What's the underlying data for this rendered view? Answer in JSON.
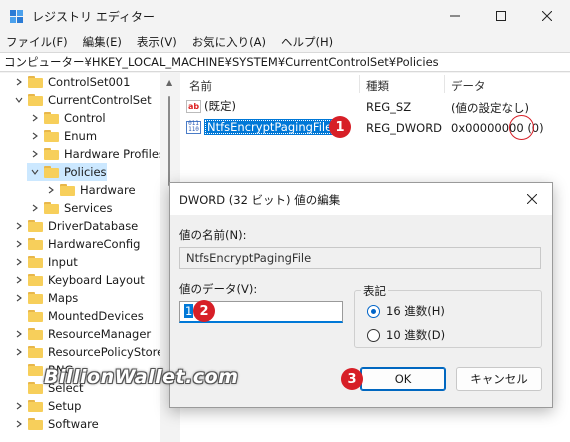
{
  "window": {
    "title": "レジストリ エディター",
    "app_icon": "registry-editor-icon",
    "controls": [
      "minimize-icon",
      "maximize-icon",
      "close-icon"
    ]
  },
  "menu": {
    "items": [
      "ファイル(F)",
      "編集(E)",
      "表示(V)",
      "お気に入り(A)",
      "ヘルプ(H)"
    ]
  },
  "address": {
    "path": "コンピューター¥HKEY_LOCAL_MACHINE¥SYSTEM¥CurrentControlSet¥Policies"
  },
  "tree": {
    "items": [
      {
        "label": "ControlSet001",
        "expander": "chevron-right",
        "selected": false
      },
      {
        "label": "CurrentControlSet",
        "expander": "chevron-down",
        "selected": false
      },
      {
        "label": "Control",
        "expander": "chevron-right",
        "selected": false
      },
      {
        "label": "Enum",
        "expander": "chevron-right",
        "selected": false
      },
      {
        "label": "Hardware Profiles",
        "expander": "chevron-right",
        "selected": false
      },
      {
        "label": "Policies",
        "expander": "chevron-down",
        "selected": true
      },
      {
        "label": "Hardware",
        "expander": "chevron-right",
        "selected": false
      },
      {
        "label": "Services",
        "expander": "chevron-right",
        "selected": false
      },
      {
        "label": "DriverDatabase",
        "expander": "chevron-right",
        "selected": false
      },
      {
        "label": "HardwareConfig",
        "expander": "chevron-right",
        "selected": false
      },
      {
        "label": "Input",
        "expander": "chevron-right",
        "selected": false
      },
      {
        "label": "Keyboard Layout",
        "expander": "chevron-right",
        "selected": false
      },
      {
        "label": "Maps",
        "expander": "chevron-right",
        "selected": false
      },
      {
        "label": "MountedDevices",
        "expander": "none",
        "selected": false
      },
      {
        "label": "ResourceManager",
        "expander": "chevron-right",
        "selected": false
      },
      {
        "label": "ResourcePolicyStore",
        "expander": "chevron-right",
        "selected": false
      },
      {
        "label": "RNG",
        "expander": "none",
        "selected": false
      },
      {
        "label": "Select",
        "expander": "none",
        "selected": false
      },
      {
        "label": "Setup",
        "expander": "chevron-right",
        "selected": false
      },
      {
        "label": "Software",
        "expander": "chevron-right",
        "selected": false
      }
    ]
  },
  "list": {
    "headers": {
      "name": "名前",
      "type": "種類",
      "data": "データ"
    },
    "rows": [
      {
        "icon": "string-value-icon",
        "name": "(既定)",
        "type": "REG_SZ",
        "data": "(値の設定なし)",
        "selected": false
      },
      {
        "icon": "binary-value-icon",
        "name": "NtfsEncryptPagingFile",
        "type": "REG_DWORD",
        "data": "0x00000000",
        "data_suffix": "(0)",
        "selected": true
      }
    ]
  },
  "annotations": {
    "step1": "1",
    "step2": "2",
    "step3": "3",
    "accent": "#d71f27"
  },
  "dialog": {
    "title": "DWORD (32 ビット) 値の編集",
    "value_name_label": "値の名前(N):",
    "value_name": "NtfsEncryptPagingFile",
    "value_data_label": "値のデータ(V):",
    "value_data": "1",
    "base_label": "表記",
    "base_options": [
      {
        "label": "16 進数(H)",
        "checked": true
      },
      {
        "label": "10 進数(D)",
        "checked": false
      }
    ],
    "ok_label": "OK",
    "cancel_label": "キャンセル"
  },
  "watermark": "BillionWallet.com"
}
